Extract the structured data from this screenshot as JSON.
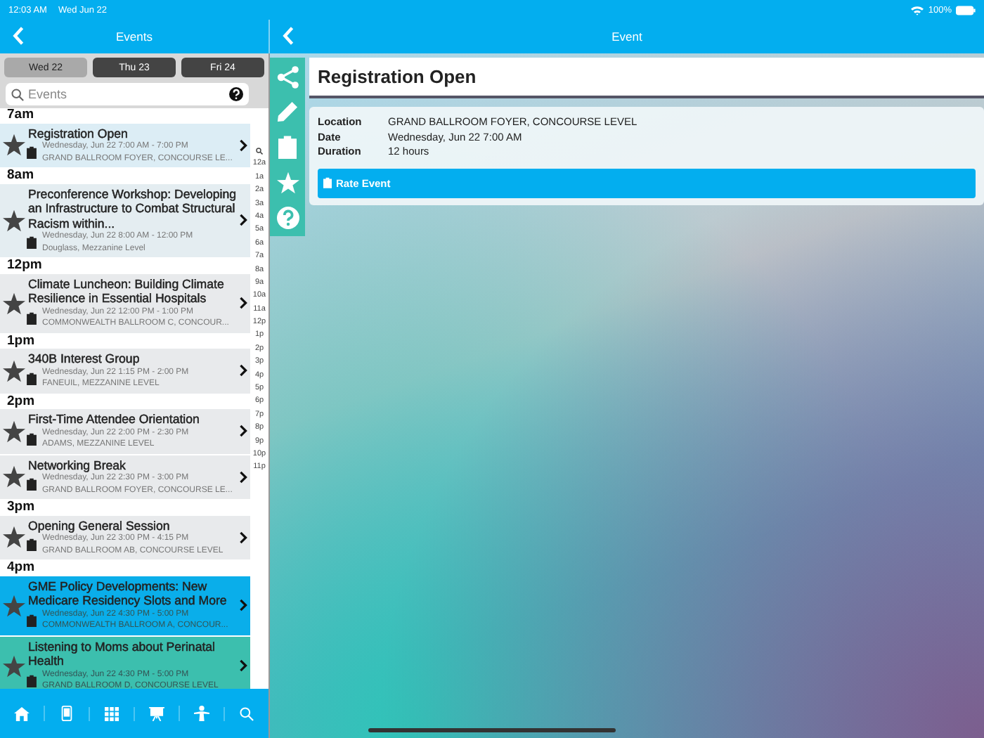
{
  "status_bar": {
    "time": "12:03 AM",
    "date": "Wed Jun 22",
    "battery": "100%"
  },
  "left_header": {
    "title": "Events"
  },
  "day_tabs": [
    {
      "label": "Wed 22",
      "selected": true
    },
    {
      "label": "Thu 23",
      "selected": false
    },
    {
      "label": "Fri 24",
      "selected": false
    }
  ],
  "search": {
    "placeholder": "Events"
  },
  "sections": [
    {
      "time": "7am",
      "events": [
        {
          "title": "Registration Open",
          "when": "Wednesday, Jun 22 7:00 AM - 7:00 PM",
          "location": "GRAND BALLROOM FOYER, CONCOURSE LE...",
          "color": "#dcedf5"
        }
      ]
    },
    {
      "time": "8am",
      "events": [
        {
          "title": "Preconference Workshop: Developing an Infrastructure to Combat Structural Racism within...",
          "when": "Wednesday, Jun 22 8:00 AM - 12:00 PM",
          "location": "Douglass, Mezzanine Level",
          "color": "#e4edf1"
        }
      ]
    },
    {
      "time": "12pm",
      "events": [
        {
          "title": "Climate Luncheon: Building Climate Resilience in Essential Hospitals",
          "when": "Wednesday, Jun 22 12:00 PM - 1:00 PM",
          "location": "COMMONWEALTH BALLROOM C, CONCOUR...",
          "color": "#e8eaec"
        }
      ]
    },
    {
      "time": "1pm",
      "events": [
        {
          "title": "340B Interest Group",
          "when": "Wednesday, Jun 22 1:15 PM - 2:00 PM",
          "location": "FANEUIL, MEZZANINE LEVEL",
          "color": "#e8eaec"
        }
      ]
    },
    {
      "time": "2pm",
      "events": [
        {
          "title": "First-Time Attendee Orientation",
          "when": "Wednesday, Jun 22 2:00 PM - 2:30 PM",
          "location": "ADAMS, MEZZANINE LEVEL",
          "color": "#e8eaec"
        },
        {
          "title": "Networking Break",
          "when": "Wednesday, Jun 22 2:30 PM - 3:00 PM",
          "location": "GRAND BALLROOM FOYER, CONCOURSE LE...",
          "color": "#e8eaec"
        }
      ]
    },
    {
      "time": "3pm",
      "events": [
        {
          "title": "Opening General Session",
          "when": "Wednesday, Jun 22 3:00 PM - 4:15 PM",
          "location": "GRAND BALLROOM AB, CONCOURSE LEVEL",
          "color": "#e8eaec"
        }
      ]
    },
    {
      "time": "4pm",
      "events": [
        {
          "title": "GME Policy Developments: New Medicare Residency Slots and More",
          "when": "Wednesday, Jun 22 4:30 PM - 5:00 PM",
          "location": "COMMONWEALTH BALLROOM A, CONCOUR...",
          "color": "#0aaeea"
        },
        {
          "title": "Listening to Moms about Perinatal Health",
          "when": "Wednesday, Jun 22 4:30 PM - 5:00 PM",
          "location": "GRAND BALLROOM D, CONCOURSE LEVEL",
          "color": "#3cbfae"
        }
      ]
    }
  ],
  "index": [
    "12a",
    "1a",
    "2a",
    "3a",
    "4a",
    "5a",
    "6a",
    "7a",
    "8a",
    "9a",
    "10a",
    "11a",
    "12p",
    "1p",
    "2p",
    "3p",
    "4p",
    "5p",
    "6p",
    "7p",
    "8p",
    "9p",
    "10p",
    "11p"
  ],
  "detail": {
    "header": "Event",
    "title": "Registration Open",
    "fields": [
      {
        "label": "Location",
        "value": "GRAND BALLROOM FOYER, CONCOURSE LEVEL"
      },
      {
        "label": "Date",
        "value": "Wednesday, Jun 22 7:00 AM"
      },
      {
        "label": "Duration",
        "value": "12 hours"
      }
    ],
    "button": "Rate Event"
  }
}
